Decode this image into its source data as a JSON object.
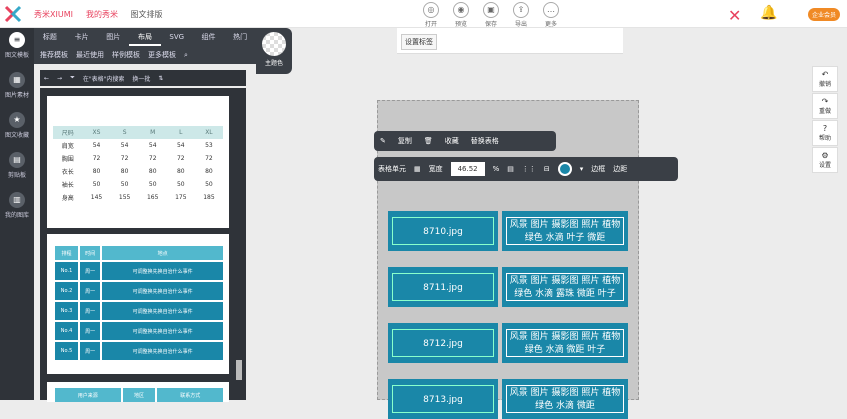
{
  "header": {
    "brand": "秀米XIUMI",
    "crumbs": [
      "我的秀米",
      "图文排版"
    ],
    "tools": [
      "打开",
      "预览",
      "保存",
      "导出",
      "更多"
    ],
    "badge": "企业会员"
  },
  "leftnav": [
    {
      "label": "图文模板",
      "icon": "layers-icon",
      "active": true
    },
    {
      "label": "图片素材",
      "icon": "image-icon"
    },
    {
      "label": "图文收藏",
      "icon": "bookmark-icon"
    },
    {
      "label": "剪贴板",
      "icon": "clipboard-icon"
    },
    {
      "label": "我的图库",
      "icon": "gallery-icon"
    }
  ],
  "tabs": [
    "标题",
    "卡片",
    "图片",
    "布局",
    "SVG",
    "组件",
    "热门"
  ],
  "subtabs": [
    "推荐模板",
    "最近使用",
    "样例模板",
    "更多模板"
  ],
  "theme_label": "主题色",
  "filter": {
    "label": "在\"表格\"内搜索",
    "action": "换一批"
  },
  "size_table": {
    "header": [
      "尺码",
      "XS",
      "S",
      "M",
      "L",
      "XL"
    ],
    "rows": [
      [
        "肩宽",
        "54",
        "54",
        "54",
        "54",
        "53"
      ],
      [
        "胸围",
        "72",
        "72",
        "72",
        "72",
        "72"
      ],
      [
        "衣长",
        "80",
        "80",
        "80",
        "80",
        "80"
      ],
      [
        "袖长",
        "50",
        "50",
        "50",
        "50",
        "50"
      ],
      [
        "身高",
        "145",
        "155",
        "165",
        "175",
        "185"
      ]
    ]
  },
  "schedule": {
    "header": [
      "排程",
      "时间",
      "地点"
    ],
    "rows": [
      [
        "No.1",
        "周一",
        "可调整换先换自治什么事件"
      ],
      [
        "No.2",
        "周一",
        "可调整换先换自治什么事件"
      ],
      [
        "No.3",
        "周一",
        "可调整换先换自治什么事件"
      ],
      [
        "No.4",
        "周一",
        "可调整换先换自治什么事件"
      ],
      [
        "No.5",
        "周一",
        "可调整换先换自治什么事件"
      ]
    ]
  },
  "card3_header": [
    "用户来源",
    "地区",
    "联系方式"
  ],
  "tooltip": "设置标签",
  "toolbar1": [
    "复制",
    "收藏",
    "替换表格"
  ],
  "toolbar2": {
    "cell": "表格单元",
    "width_label": "宽度",
    "width_value": "46.52",
    "unit": "%",
    "border": "边框",
    "margin": "边距"
  },
  "canvas": {
    "images": [
      "8710.jpg",
      "8711.jpg",
      "8712.jpg",
      "8713.jpg"
    ],
    "texts": [
      "风景 图片 摄影图 照片 植物 绿色 水滴 叶子 微距",
      "风景 图片 摄影图 照片 植物 绿色 水滴 露珠 微距 叶子",
      "风景 图片 摄影图 照片 植物 绿色 水滴 微距 叶子",
      "风景 图片 摄影图 照片 植物 绿色 水滴 微距"
    ]
  },
  "rightbar": [
    {
      "label": "撤销",
      "icon": "undo-icon"
    },
    {
      "label": "重做",
      "icon": "redo-icon"
    },
    {
      "label": "帮助",
      "icon": "help-icon"
    },
    {
      "label": "设置",
      "icon": "gear-icon"
    }
  ],
  "colors": {
    "accent": "#1a87a8",
    "brand": "#e8435f",
    "dark": "#3a3f46"
  }
}
